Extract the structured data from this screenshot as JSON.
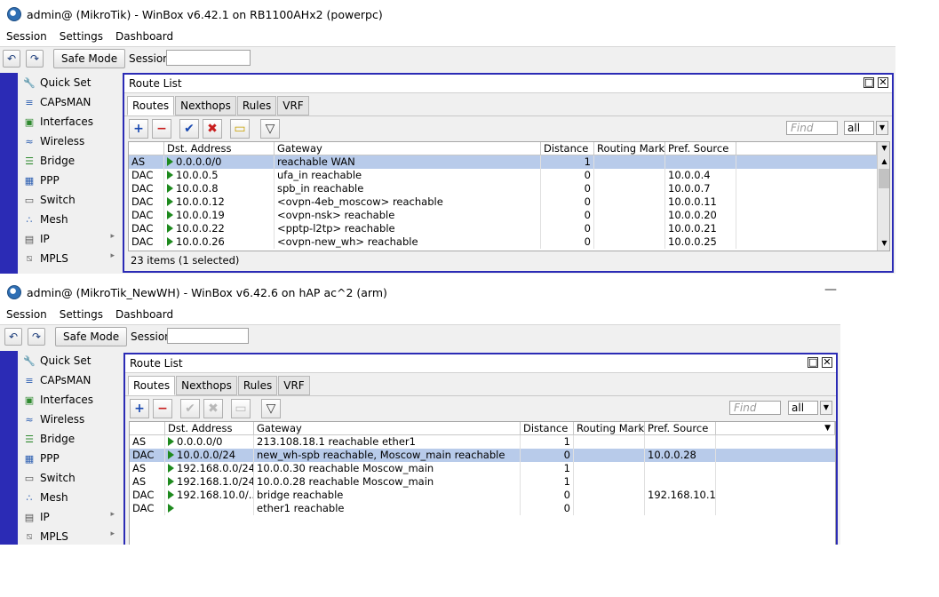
{
  "window1": {
    "title": "admin@ (MikroTik) - WinBox v6.42.1 on RB1100AHx2 (powerpc)",
    "menu": [
      "Session",
      "Settings",
      "Dashboard"
    ],
    "toolbar": {
      "undo_icon": "undo-icon",
      "redo_icon": "redo-icon",
      "safe_mode": "Safe Mode",
      "session_label": "Session:",
      "session_value": ""
    },
    "sidebar": [
      {
        "label": "Quick Set",
        "icon": "quick-set-icon"
      },
      {
        "label": "CAPsMAN",
        "icon": "capsman-icon"
      },
      {
        "label": "Interfaces",
        "icon": "interfaces-icon"
      },
      {
        "label": "Wireless",
        "icon": "wireless-icon"
      },
      {
        "label": "Bridge",
        "icon": "bridge-icon"
      },
      {
        "label": "PPP",
        "icon": "ppp-icon"
      },
      {
        "label": "Switch",
        "icon": "switch-icon"
      },
      {
        "label": "Mesh",
        "icon": "mesh-icon"
      },
      {
        "label": "IP",
        "icon": "ip-icon"
      },
      {
        "label": "MPLS",
        "icon": "mpls-icon"
      }
    ],
    "route_list": {
      "title": "Route List",
      "tabs": [
        "Routes",
        "Nexthops",
        "Rules",
        "VRF"
      ],
      "find_placeholder": "Find",
      "filter_value": "all",
      "columns": [
        "",
        "Dst. Address",
        "Gateway",
        "Distance",
        "Routing Mark",
        "Pref. Source"
      ],
      "rows": [
        {
          "flags": "AS",
          "dst": "0.0.0.0/0",
          "gateway": "reachable WAN",
          "distance": "1",
          "mark": "",
          "pref": "",
          "selected": true
        },
        {
          "flags": "DAC",
          "dst": "10.0.0.5",
          "gateway": "ufa_in reachable",
          "distance": "0",
          "mark": "",
          "pref": "10.0.0.4",
          "selected": false
        },
        {
          "flags": "DAC",
          "dst": "10.0.0.8",
          "gateway": "spb_in reachable",
          "distance": "0",
          "mark": "",
          "pref": "10.0.0.7",
          "selected": false
        },
        {
          "flags": "DAC",
          "dst": "10.0.0.12",
          "gateway": "<ovpn-4eb_moscow> reachable",
          "distance": "0",
          "mark": "",
          "pref": "10.0.0.11",
          "selected": false
        },
        {
          "flags": "DAC",
          "dst": "10.0.0.19",
          "gateway": "<ovpn-nsk> reachable",
          "distance": "0",
          "mark": "",
          "pref": "10.0.0.20",
          "selected": false
        },
        {
          "flags": "DAC",
          "dst": "10.0.0.22",
          "gateway": "<pptp-l2tp> reachable",
          "distance": "0",
          "mark": "",
          "pref": "10.0.0.21",
          "selected": false
        },
        {
          "flags": "DAC",
          "dst": "10.0.0.26",
          "gateway": "<ovpn-new_wh> reachable",
          "distance": "0",
          "mark": "",
          "pref": "10.0.0.25",
          "selected": false
        }
      ],
      "status": "23 items (1 selected)"
    }
  },
  "window2": {
    "title": "admin@ (MikroTik_NewWH) - WinBox v6.42.6 on hAP ac^2 (arm)",
    "menu": [
      "Session",
      "Settings",
      "Dashboard"
    ],
    "toolbar": {
      "undo_icon": "undo-icon",
      "redo_icon": "redo-icon",
      "safe_mode": "Safe Mode",
      "session_label": "Session:",
      "session_value": ""
    },
    "sidebar": [
      {
        "label": "Quick Set",
        "icon": "quick-set-icon"
      },
      {
        "label": "CAPsMAN",
        "icon": "capsman-icon"
      },
      {
        "label": "Interfaces",
        "icon": "interfaces-icon"
      },
      {
        "label": "Wireless",
        "icon": "wireless-icon"
      },
      {
        "label": "Bridge",
        "icon": "bridge-icon"
      },
      {
        "label": "PPP",
        "icon": "ppp-icon"
      },
      {
        "label": "Switch",
        "icon": "switch-icon"
      },
      {
        "label": "Mesh",
        "icon": "mesh-icon"
      },
      {
        "label": "IP",
        "icon": "ip-icon"
      },
      {
        "label": "MPLS",
        "icon": "mpls-icon"
      }
    ],
    "route_list": {
      "title": "Route List",
      "tabs": [
        "Routes",
        "Nexthops",
        "Rules",
        "VRF"
      ],
      "find_placeholder": "Find",
      "filter_value": "all",
      "columns": [
        "",
        "Dst. Address",
        "Gateway",
        "Distance",
        "Routing Mark",
        "Pref. Source"
      ],
      "rows": [
        {
          "flags": "AS",
          "dst": "0.0.0.0/0",
          "gateway": "213.108.18.1 reachable ether1",
          "distance": "1",
          "mark": "",
          "pref": "",
          "selected": false
        },
        {
          "flags": "DAC",
          "dst": "10.0.0.0/24",
          "gateway": "new_wh-spb reachable, Moscow_main reachable",
          "distance": "0",
          "mark": "",
          "pref": "10.0.0.28",
          "selected": true
        },
        {
          "flags": "AS",
          "dst": "192.168.0.0/24",
          "gateway": "10.0.0.30 reachable Moscow_main",
          "distance": "1",
          "mark": "",
          "pref": "",
          "selected": false
        },
        {
          "flags": "AS",
          "dst": "192.168.1.0/24",
          "gateway": "10.0.0.28 reachable Moscow_main",
          "distance": "1",
          "mark": "",
          "pref": "",
          "selected": false
        },
        {
          "flags": "DAC",
          "dst": "192.168.10.0/...",
          "gateway": "bridge reachable",
          "distance": "0",
          "mark": "",
          "pref": "192.168.10.1",
          "selected": false
        },
        {
          "flags": "DAC",
          "dst": "",
          "gateway": "ether1 reachable",
          "distance": "0",
          "mark": "",
          "pref": "",
          "selected": false
        }
      ]
    }
  }
}
